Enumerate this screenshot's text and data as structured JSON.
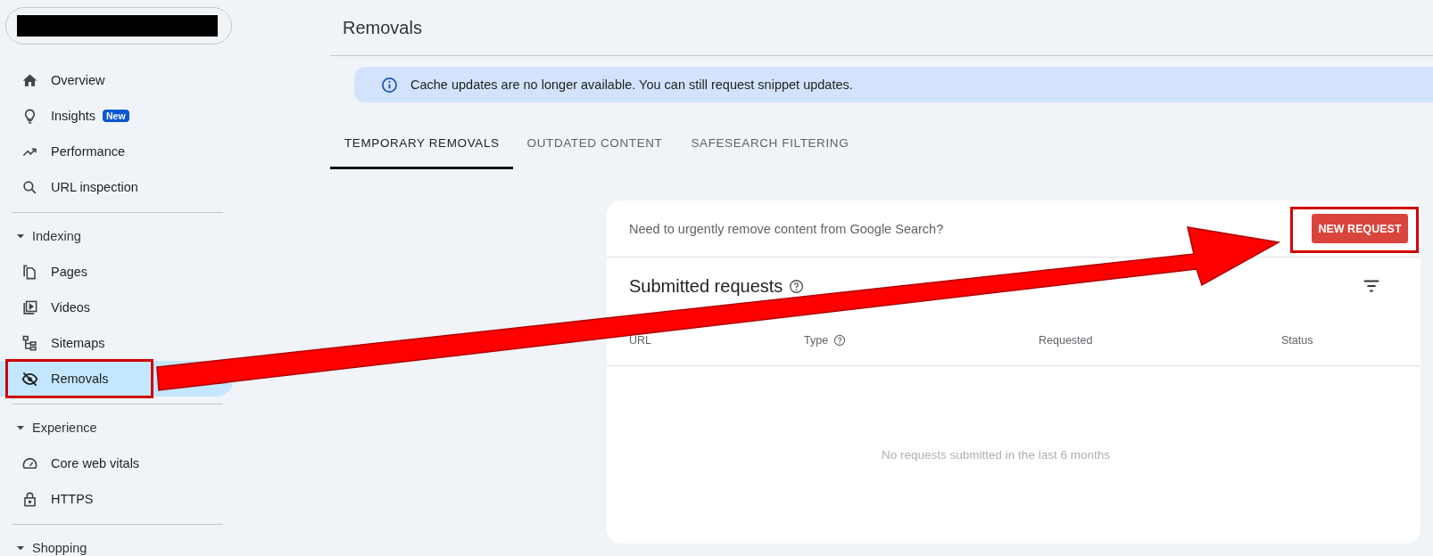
{
  "sidebar": {
    "sections": [
      {
        "items": [
          {
            "label": "Overview",
            "kind": "home",
            "selected": false
          },
          {
            "label": "Insights",
            "kind": "bulb",
            "badge": "New",
            "selected": false
          },
          {
            "label": "Performance",
            "kind": "trend",
            "selected": false
          },
          {
            "label": "URL inspection",
            "kind": "search",
            "selected": false
          }
        ]
      },
      {
        "title": "Indexing",
        "expanded": true,
        "items": [
          {
            "label": "Pages",
            "kind": "pages",
            "selected": false
          },
          {
            "label": "Videos",
            "kind": "video",
            "selected": false
          },
          {
            "label": "Sitemaps",
            "kind": "sitemap",
            "selected": false
          },
          {
            "label": "Removals",
            "kind": "eyeoff",
            "selected": true,
            "callout": true
          }
        ]
      },
      {
        "title": "Experience",
        "expanded": true,
        "items": [
          {
            "label": "Core web vitals",
            "kind": "gauge",
            "selected": false
          },
          {
            "label": "HTTPS",
            "kind": "lock",
            "selected": false
          }
        ]
      },
      {
        "title": "Shopping",
        "expanded": true
      }
    ]
  },
  "page": {
    "title": "Removals"
  },
  "banner": {
    "text": "Cache updates are no longer available. You can still request snippet updates."
  },
  "tabs": [
    {
      "label": "TEMPORARY REMOVALS",
      "selected": true
    },
    {
      "label": "OUTDATED CONTENT",
      "selected": false
    },
    {
      "label": "SAFESEARCH FILTERING",
      "selected": false
    }
  ],
  "card": {
    "prompt": "Need to urgently remove content from Google Search?",
    "button": {
      "label": "NEW REQUEST",
      "callout": true
    },
    "title": "Submitted requests",
    "table": {
      "columns": [
        {
          "label": "URL",
          "help": false
        },
        {
          "label": "Type",
          "help": true
        },
        {
          "label": "Requested",
          "help": false
        },
        {
          "label": "Status",
          "help": false
        }
      ],
      "empty_message": "No requests submitted in the last 6 months"
    }
  },
  "annotation": {
    "arrow": true
  }
}
